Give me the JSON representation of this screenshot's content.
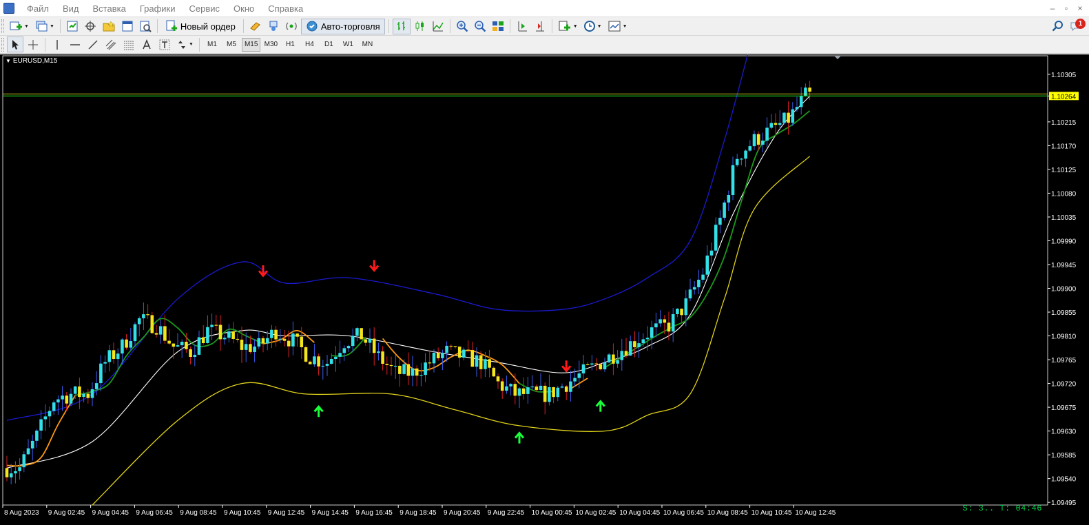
{
  "menu": [
    "Файл",
    "Вид",
    "Вставка",
    "Графики",
    "Сервис",
    "Окно",
    "Справка"
  ],
  "window_controls": [
    "–",
    "▫",
    "×"
  ],
  "toolbar": {
    "new_order_label": "Новый ордер",
    "autotrading_label": "Авто-торговля"
  },
  "timeframes": [
    "M1",
    "M5",
    "M15",
    "M30",
    "H1",
    "H4",
    "D1",
    "W1",
    "MN"
  ],
  "active_timeframe": "M15",
  "notification_count": "1",
  "chart": {
    "symbol_label": "EURUSD,M15",
    "status_text": "S: 3.. T: 04:46",
    "colors": {
      "background": "#000000",
      "bull": "#33e0e8",
      "bear": "#f5e51c",
      "wick_up": "#3a5ff0",
      "wick_down": "#e02020",
      "bb_upper": "#1a1ad0",
      "bb_middle": "#ffffff",
      "bb_lower": "#e0d21a",
      "fast_line_up": "#1a9a1a",
      "fast_line_down": "#ff9a10",
      "arrow_sell": "#ff1a1a",
      "arrow_buy": "#1aff3a",
      "price_line": "#1ee81e",
      "price_label_bg": "#ffff00"
    }
  },
  "chart_data": {
    "type": "candlestick",
    "symbol": "EURUSD",
    "timeframe": "M15",
    "current_price": 1.10264,
    "y_ticks": [
      "1.10305",
      "1.10264",
      "1.10215",
      "1.10170",
      "1.10125",
      "1.10080",
      "1.10035",
      "1.09990",
      "1.09945",
      "1.09900",
      "1.09855",
      "1.09810",
      "1.09765",
      "1.09720",
      "1.09675",
      "1.09630",
      "1.09585",
      "1.09540",
      "1.09495"
    ],
    "x_ticks": [
      "8 Aug 2023",
      "9 Aug 02:45",
      "9 Aug 04:45",
      "9 Aug 06:45",
      "9 Aug 08:45",
      "9 Aug 10:45",
      "9 Aug 12:45",
      "9 Aug 14:45",
      "9 Aug 16:45",
      "9 Aug 18:45",
      "9 Aug 20:45",
      "9 Aug 22:45",
      "10 Aug 00:45",
      "10 Aug 02:45",
      "10 Aug 04:45",
      "10 Aug 06:45",
      "10 Aug 08:45",
      "10 Aug 10:45",
      "10 Aug 12:45"
    ],
    "ylim": [
      1.0949,
      1.1034
    ],
    "close_path": [
      [
        0,
        1.0956
      ],
      [
        4,
        1.0956
      ],
      [
        8,
        1.0962
      ],
      [
        12,
        1.0969
      ],
      [
        16,
        1.097
      ],
      [
        20,
        1.097
      ],
      [
        24,
        1.0976
      ],
      [
        28,
        1.0979
      ],
      [
        32,
        1.0984
      ],
      [
        36,
        1.0983
      ],
      [
        40,
        1.0979
      ],
      [
        44,
        1.0978
      ],
      [
        48,
        1.0982
      ],
      [
        52,
        1.0981
      ],
      [
        56,
        1.0979
      ],
      [
        60,
        1.0979
      ],
      [
        64,
        1.0982
      ],
      [
        68,
        1.098
      ],
      [
        72,
        1.0977
      ],
      [
        76,
        1.0976
      ],
      [
        80,
        1.098
      ],
      [
        84,
        1.0981
      ],
      [
        88,
        1.0977
      ],
      [
        92,
        1.0974
      ],
      [
        96,
        1.0974
      ],
      [
        100,
        1.0976
      ],
      [
        104,
        1.0978
      ],
      [
        108,
        1.0977
      ],
      [
        112,
        1.0976
      ],
      [
        116,
        1.0972
      ],
      [
        120,
        1.097
      ],
      [
        124,
        1.097
      ],
      [
        128,
        1.097
      ],
      [
        132,
        1.0972
      ],
      [
        136,
        1.0974
      ],
      [
        140,
        1.0976
      ],
      [
        144,
        1.0978
      ],
      [
        148,
        1.098
      ],
      [
        152,
        1.0982
      ],
      [
        156,
        1.0983
      ],
      [
        160,
        1.0987
      ],
      [
        164,
        1.0993
      ],
      [
        168,
        1.1003
      ],
      [
        172,
        1.1015
      ],
      [
        176,
        1.1018
      ],
      [
        180,
        1.102
      ],
      [
        184,
        1.1022
      ],
      [
        188,
        1.10264
      ]
    ],
    "bollinger_bands": {
      "upper": [
        [
          0,
          1.0965
        ],
        [
          20,
          1.097
        ],
        [
          40,
          1.0988
        ],
        [
          55,
          1.0995
        ],
        [
          65,
          1.0991
        ],
        [
          80,
          1.0992
        ],
        [
          100,
          1.0989
        ],
        [
          115,
          1.0986
        ],
        [
          130,
          1.0986
        ],
        [
          140,
          1.0988
        ],
        [
          150,
          1.0992
        ],
        [
          160,
          1.0999
        ],
        [
          168,
          1.1018
        ],
        [
          175,
          1.1039
        ]
      ],
      "middle": [
        [
          0,
          1.0956
        ],
        [
          20,
          1.0961
        ],
        [
          40,
          1.0978
        ],
        [
          55,
          1.0982
        ],
        [
          65,
          1.0981
        ],
        [
          80,
          1.0981
        ],
        [
          100,
          1.0978
        ],
        [
          115,
          1.0976
        ],
        [
          130,
          1.0974
        ],
        [
          140,
          1.0976
        ],
        [
          150,
          1.0979
        ],
        [
          160,
          1.0985
        ],
        [
          170,
          1.1004
        ],
        [
          180,
          1.1019
        ],
        [
          188,
          1.10264
        ]
      ],
      "lower": [
        [
          20,
          1.0949
        ],
        [
          40,
          1.0965
        ],
        [
          55,
          1.0972
        ],
        [
          70,
          1.097
        ],
        [
          90,
          1.097
        ],
        [
          105,
          1.0967
        ],
        [
          120,
          1.0964
        ],
        [
          140,
          1.0963
        ],
        [
          150,
          1.0966
        ],
        [
          160,
          1.097
        ],
        [
          168,
          1.0988
        ],
        [
          175,
          1.1005
        ],
        [
          188,
          1.1015
        ]
      ]
    },
    "signals": [
      {
        "type": "sell",
        "bar": 60,
        "price": 1.0992
      },
      {
        "type": "buy",
        "bar": 73,
        "price": 1.0968
      },
      {
        "type": "sell",
        "bar": 86,
        "price": 1.0993
      },
      {
        "type": "buy",
        "bar": 120,
        "price": 1.0963
      },
      {
        "type": "sell",
        "bar": 131,
        "price": 1.0974
      },
      {
        "type": "buy",
        "bar": 139,
        "price": 1.0969
      }
    ]
  }
}
